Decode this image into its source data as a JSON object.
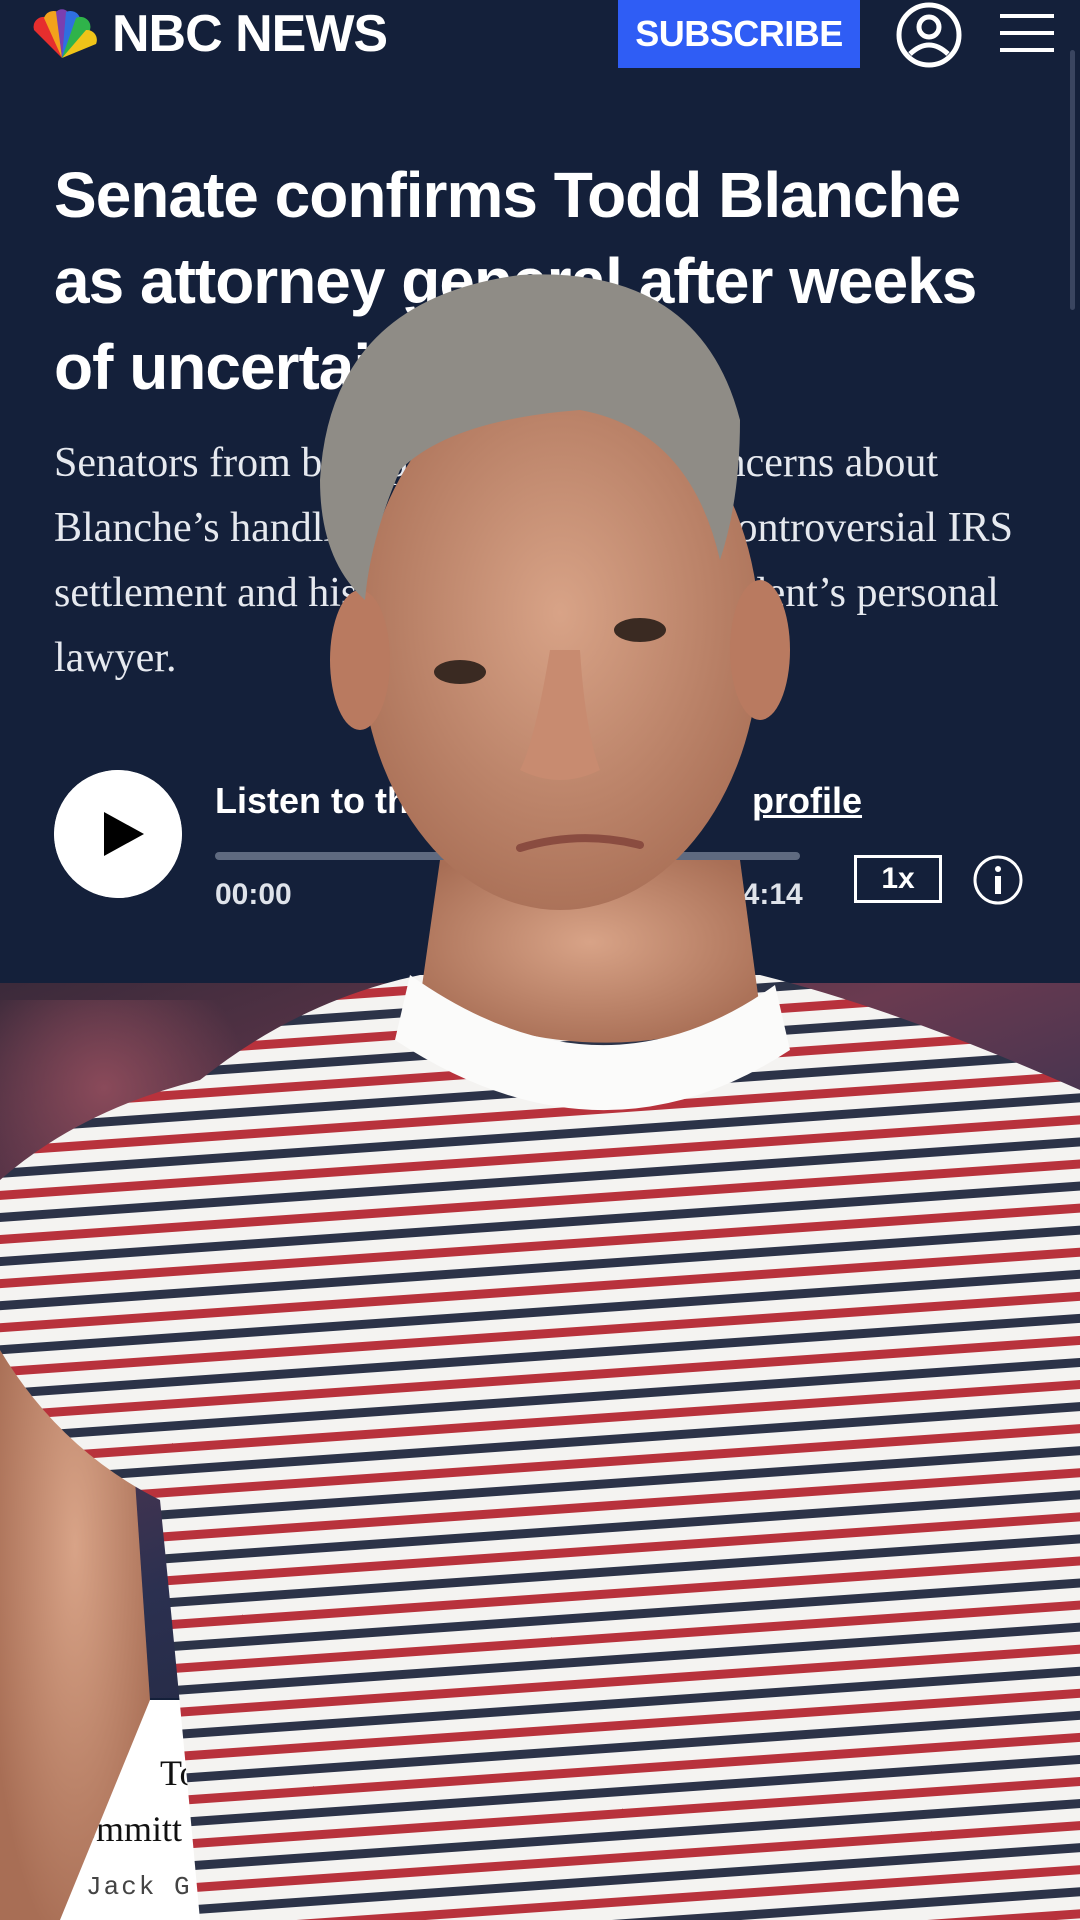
{
  "header": {
    "brand": "NBC NEWS",
    "subscribe_label": "SUBSCRIBE",
    "account_icon": "account-icon",
    "menu_icon": "hamburger-menu-icon"
  },
  "article": {
    "headline": "Senate confirms Todd Blanche as attorney general after weeks of uncertainty",
    "dek": "Senators from both parties expressed concerns about Blanche’s handling of Donald Trump’s controversial IRS settlement and his prior work as the president’s personal lawyer."
  },
  "audio_player": {
    "listen_label": "Listen to th",
    "listen_link": "profile",
    "time_current": "00:00",
    "time_total": "04:14",
    "progress": 0.0,
    "speed_label": "1x",
    "info_icon": "info-icon"
  },
  "photo_caption": {
    "line1": "To",
    "line2": "Committ",
    "credit": "Jack G"
  },
  "colors": {
    "background": "#14203a",
    "accent": "#2f5df5"
  }
}
